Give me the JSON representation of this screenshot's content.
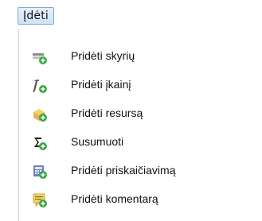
{
  "menubar": {
    "menu_label": "Įdėti"
  },
  "menu": {
    "items": [
      {
        "label": "Pridėti skyrių",
        "icon": "add-section-icon"
      },
      {
        "label": "Pridėti įkainį",
        "icon": "add-price-icon"
      },
      {
        "label": "Pridėti resursą",
        "icon": "add-resource-icon"
      },
      {
        "label": "Susumuoti",
        "icon": "sum-icon"
      },
      {
        "label": "Pridėti priskaičiavimą",
        "icon": "add-calculation-icon"
      },
      {
        "label": "Pridėti komentarą",
        "icon": "add-comment-icon"
      }
    ]
  },
  "colors": {
    "accent_green": "#3fa84a",
    "menu_button_border": "#7fa7d6",
    "menu_button_fill": "#d6e7f8"
  }
}
